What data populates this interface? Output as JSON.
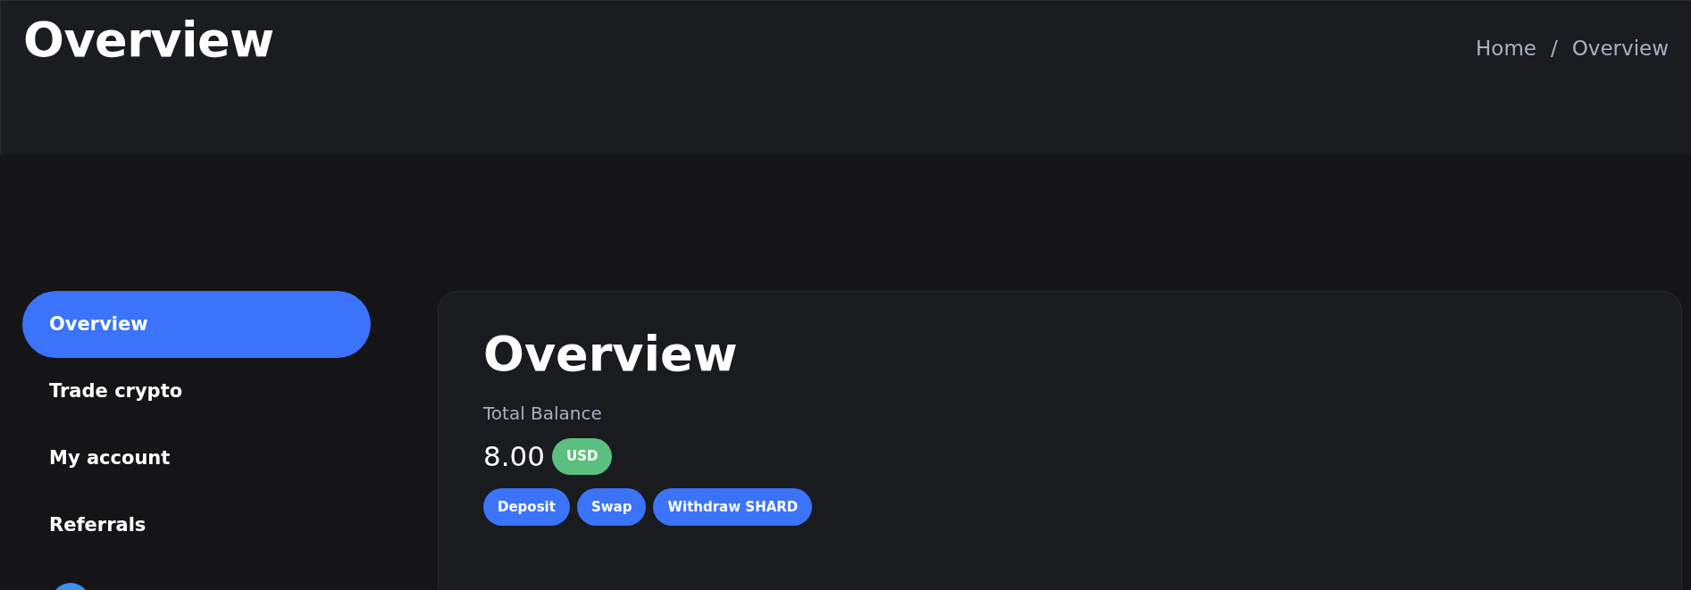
{
  "header": {
    "title": "Overview",
    "breadcrumb": [
      {
        "label": "Home"
      },
      {
        "label": "Overview"
      }
    ],
    "separator": "/"
  },
  "sidebar": {
    "items": [
      {
        "label": "Overview",
        "selected": true
      },
      {
        "label": "Trade crypto",
        "selected": false
      },
      {
        "label": "My account",
        "selected": false
      },
      {
        "label": "Referrals",
        "selected": false
      }
    ]
  },
  "card": {
    "title": "Overview",
    "balance_label": "Total Balance",
    "balance": "8.00",
    "currency": "USD",
    "buttons": [
      {
        "label": "Deposit"
      },
      {
        "label": "Swap"
      },
      {
        "label": "Withdraw SHARD"
      }
    ]
  }
}
